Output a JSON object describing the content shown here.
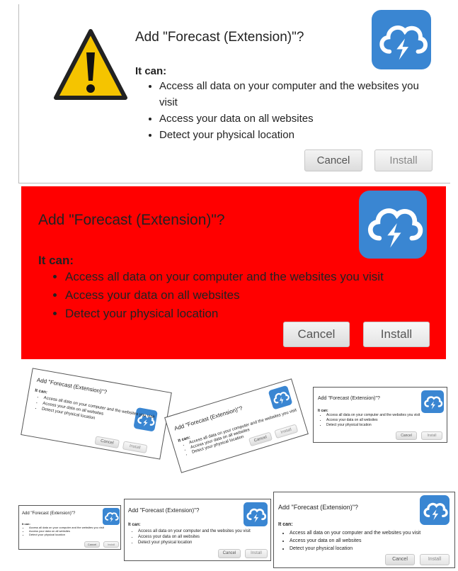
{
  "dialog": {
    "title": "Add \"Forecast (Extension)\"?",
    "it_can": "It can:",
    "permissions": [
      "Access all data on your computer and the websites you visit",
      "Access your data on all websites",
      "Detect your physical location"
    ],
    "cancel_label": "Cancel",
    "install_label": "Install"
  },
  "colors": {
    "red_background": "#ff0000",
    "icon_blue": "#3a86d2",
    "warning_yellow": "#f5c400"
  },
  "icons": {
    "warning": "warning-triangle-icon",
    "app": "cloud-lightning-icon"
  }
}
